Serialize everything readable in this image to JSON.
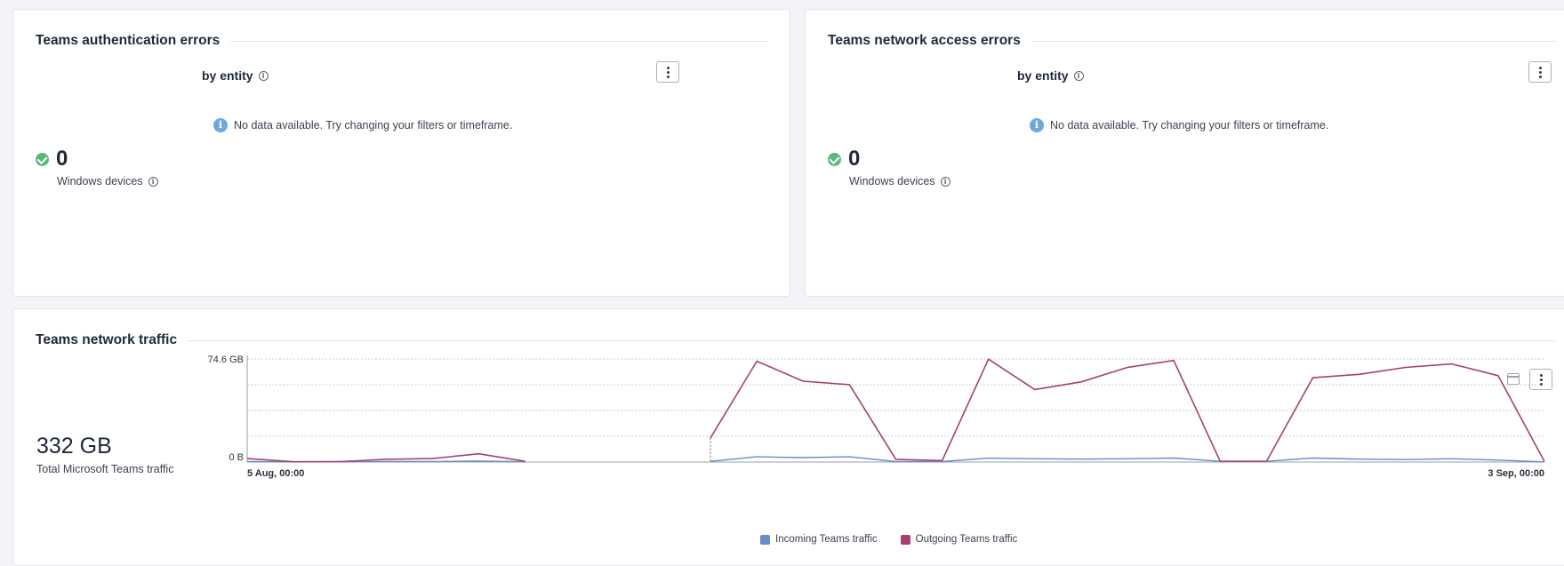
{
  "cards": {
    "auth": {
      "title": "Teams authentication errors",
      "subtitle": "by entity",
      "nodata": "No data available. Try changing your filters or timeframe.",
      "kpi_value": "0",
      "kpi_label": "Windows devices"
    },
    "net": {
      "title": "Teams network access errors",
      "subtitle": "by entity",
      "nodata": "No data available. Try changing your filters or timeframe.",
      "kpi_value": "0",
      "kpi_label": "Windows devices"
    },
    "traffic": {
      "title": "Teams network traffic",
      "total_value": "332 GB",
      "total_label": "Total Microsoft Teams traffic"
    }
  },
  "icons": {
    "info": "info-icon",
    "check": "check-circle-icon",
    "menu": "kebab-menu-icon",
    "calendar": "calendar-icon"
  },
  "colors": {
    "incoming": "#6b8cc7",
    "outgoing": "#a3426e",
    "success": "#5cb87a",
    "info": "#6fa8dc"
  },
  "chart_data": {
    "type": "line",
    "y_tick_labels": [
      "74.6 GB",
      "0 B"
    ],
    "x_tick_labels": [
      "5 Aug, 00:00",
      "3 Sep, 00:00"
    ],
    "ylim": [
      0,
      74.6
    ],
    "grid": true,
    "legend_position": "bottom",
    "x_count": 29,
    "series": [
      {
        "name": "Incoming Teams traffic",
        "color": "#6b8cc7",
        "values": [
          0.3,
          0.1,
          0.1,
          0.3,
          0.4,
          0.8,
          0.2,
          null,
          null,
          null,
          0.5,
          3.8,
          3.2,
          3.8,
          0.3,
          0.3,
          2.8,
          2.4,
          2.1,
          2.4,
          2.9,
          0.5,
          0.5,
          2.9,
          2.1,
          1.8,
          2.4,
          1.4,
          0.1
        ]
      },
      {
        "name": "Outgoing Teams traffic",
        "color": "#a3426e",
        "values": [
          2.5,
          0.2,
          0.3,
          2.0,
          2.5,
          6.0,
          0.5,
          null,
          null,
          null,
          17.5,
          73.0,
          58.5,
          56.0,
          2.0,
          1.0,
          74.5,
          52.5,
          58.0,
          68.5,
          73.5,
          0.5,
          0.5,
          61.0,
          63.5,
          68.5,
          71.0,
          62.5,
          0.5
        ]
      }
    ]
  }
}
